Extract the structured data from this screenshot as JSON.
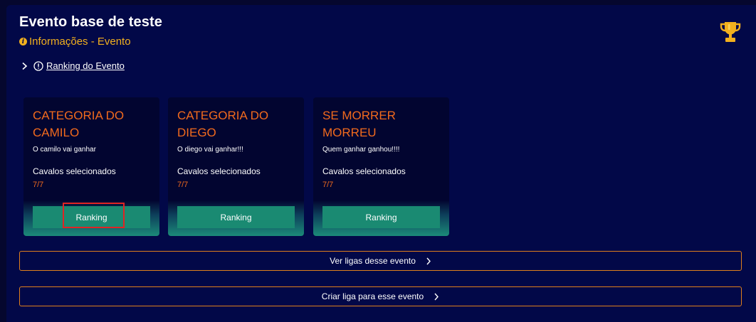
{
  "header": {
    "title": "Evento base de teste",
    "subtitle": "Informações - Evento",
    "subtitle_icon": "info-icon",
    "trophy_icon": "trophy-icon",
    "ranking_link": "Ranking do Evento"
  },
  "cards": [
    {
      "title": "CATEGORIA DO CAMILO",
      "description": "O camilo vai ganhar",
      "selected_label": "Cavalos selecionados",
      "count": "7/7",
      "button": "Ranking"
    },
    {
      "title": "CATEGORIA DO DIEGO",
      "description": "O diego vai ganhar!!!",
      "selected_label": "Cavalos selecionados",
      "count": "7/7",
      "button": "Ranking"
    },
    {
      "title": "SE MORRER MORREU",
      "description": "Quem ganhar ganhou!!!!",
      "selected_label": "Cavalos selecionados",
      "count": "7/7",
      "button": "Ranking"
    }
  ],
  "actions": {
    "view_leagues": "Ver ligas desse evento",
    "create_league": "Criar liga para esse evento"
  },
  "colors": {
    "background": "#020848",
    "accent_orange": "#f26a1d",
    "accent_gold": "#f2b01e",
    "button_green": "#1a8a72",
    "highlight_red": "#e02424"
  }
}
